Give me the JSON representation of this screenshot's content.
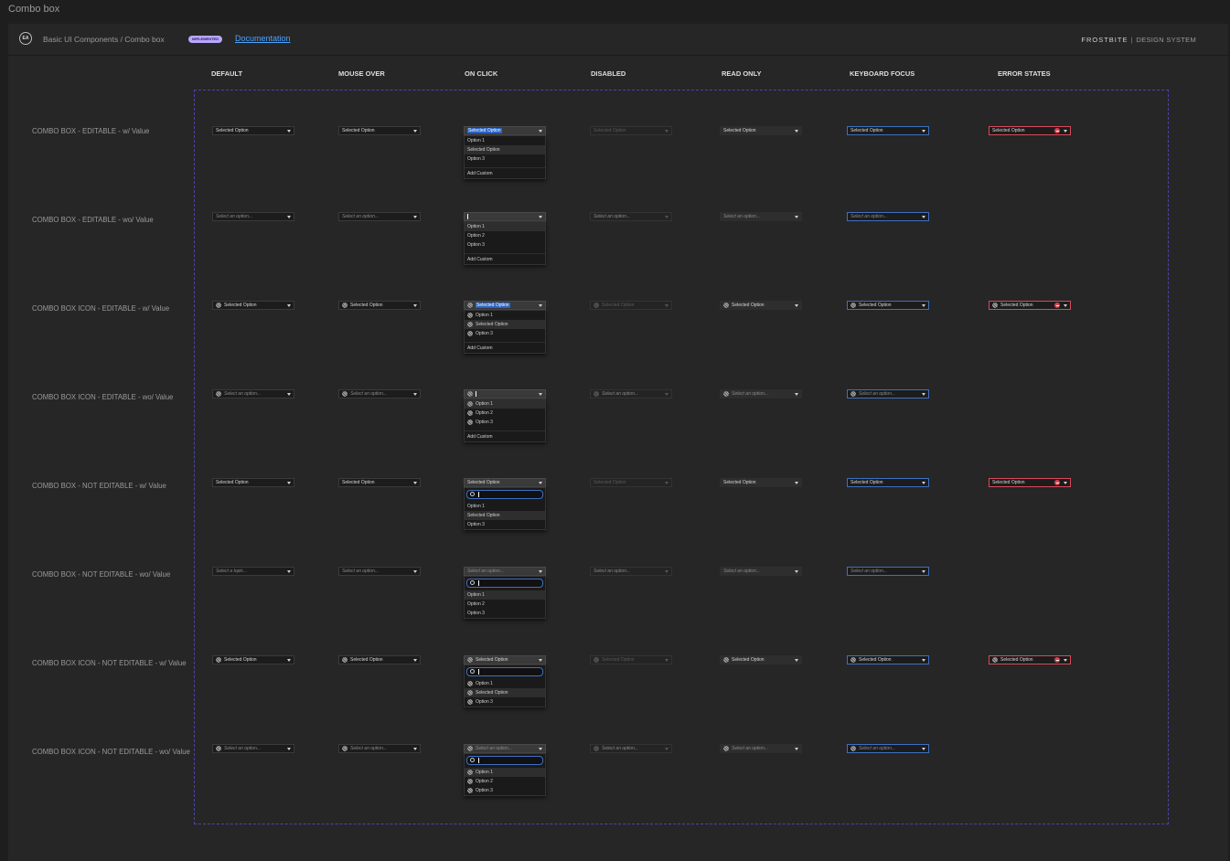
{
  "window": {
    "title": "Combo box"
  },
  "header": {
    "breadcrumb": "Basic UI Components / Combo box",
    "badge": "IMPLEMENTED",
    "doc_link": "Documentation",
    "brand_main": "FROSTBITE",
    "brand_sep": "|",
    "brand_sub": "DESIGN SYSTEM",
    "logo": "EA"
  },
  "columns": [
    "DEFAULT",
    "MOUSE OVER",
    "ON CLICK",
    "DISABLED",
    "READ ONLY",
    "KEYBOARD FOCUS",
    "ERROR STATES"
  ],
  "rows": [
    "COMBO BOX - EDITABLE - w/ Value",
    "COMBO BOX - EDITABLE - wo/ Value",
    "COMBO BOX ICON - EDITABLE - w/ Value",
    "COMBO BOX ICON - EDITABLE - wo/ Value",
    "COMBO BOX - NOT EDITABLE - w/ Value",
    "COMBO BOX - NOT EDITABLE - wo/ Value",
    "COMBO BOX ICON - NOT EDITABLE - w/ Value",
    "COMBO BOX ICON - NOT EDITABLE - wo/ Value"
  ],
  "text": {
    "selected": "Selected Option",
    "placeholder": "Select an option...",
    "placeholder_topic": "Select a topic...",
    "option1": "Option 1",
    "option2": "Option 2",
    "option3": "Option 3",
    "add_custom": "Add Custom"
  },
  "icons": {
    "combo_icon": "globe-icon",
    "error_icon": "error-icon",
    "arrow_icon": "chevron-down-icon",
    "search_icon": "search-icon"
  },
  "colors": {
    "focus": "#3f6fc2",
    "error": "#d94a5a",
    "badge": "#b9a6ff",
    "dashed_border": "#4b45a8"
  }
}
